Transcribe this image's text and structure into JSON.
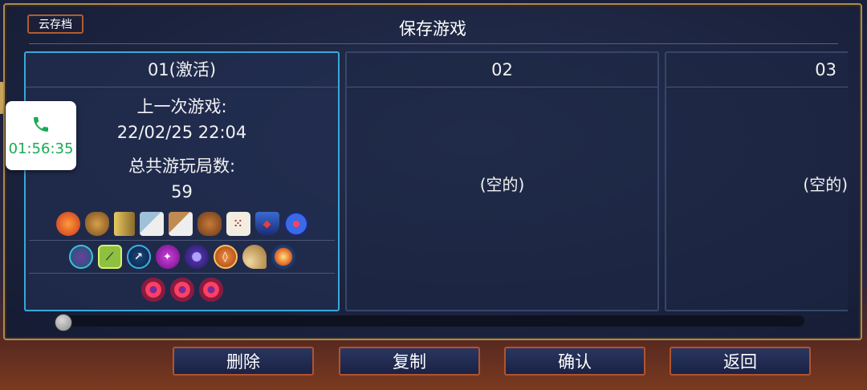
{
  "header": {
    "cloud_save_label": "云存档",
    "title": "保存游戏"
  },
  "slots": [
    {
      "name": "01(激活)",
      "active": true,
      "last_played_label": "上一次游戏:",
      "last_played_value": "22/02/25  22:04",
      "total_runs_label": "总共游玩局数:",
      "total_runs_value": "59",
      "icon_rows": [
        [
          "potion-bomb-icon",
          "coin-bag-icon",
          "torch-bars-icon",
          "sword-dice-icon",
          "bow-dice-icon",
          "shield-dice-icon",
          "dice-icon",
          "blue-shield-icon",
          "eye-orb-icon"
        ],
        [
          "rune-vine-icon",
          "rune-green-icon",
          "rune-teleport-icon",
          "rune-purple-icon",
          "rune-gear-icon",
          "rune-orange-icon",
          "horn-icon",
          "rune-spark-icon"
        ],
        [
          "red-eye-orb-icon",
          "red-eye-orb-icon",
          "red-eye-orb-icon"
        ]
      ]
    },
    {
      "name": "02",
      "active": false,
      "empty_label": "(空的)"
    },
    {
      "name": "03",
      "active": false,
      "empty_label": "(空的)"
    }
  ],
  "slider": {
    "position": 0.0
  },
  "buttons": {
    "delete": "删除",
    "copy": "复制",
    "confirm": "确认",
    "back": "返回"
  },
  "call_widget": {
    "icon": "phone-icon",
    "time": "01:56:35",
    "color": "#1aaa55"
  },
  "colors": {
    "accent_border": "#b3532c",
    "active_slot_border": "#3aa8d8"
  }
}
